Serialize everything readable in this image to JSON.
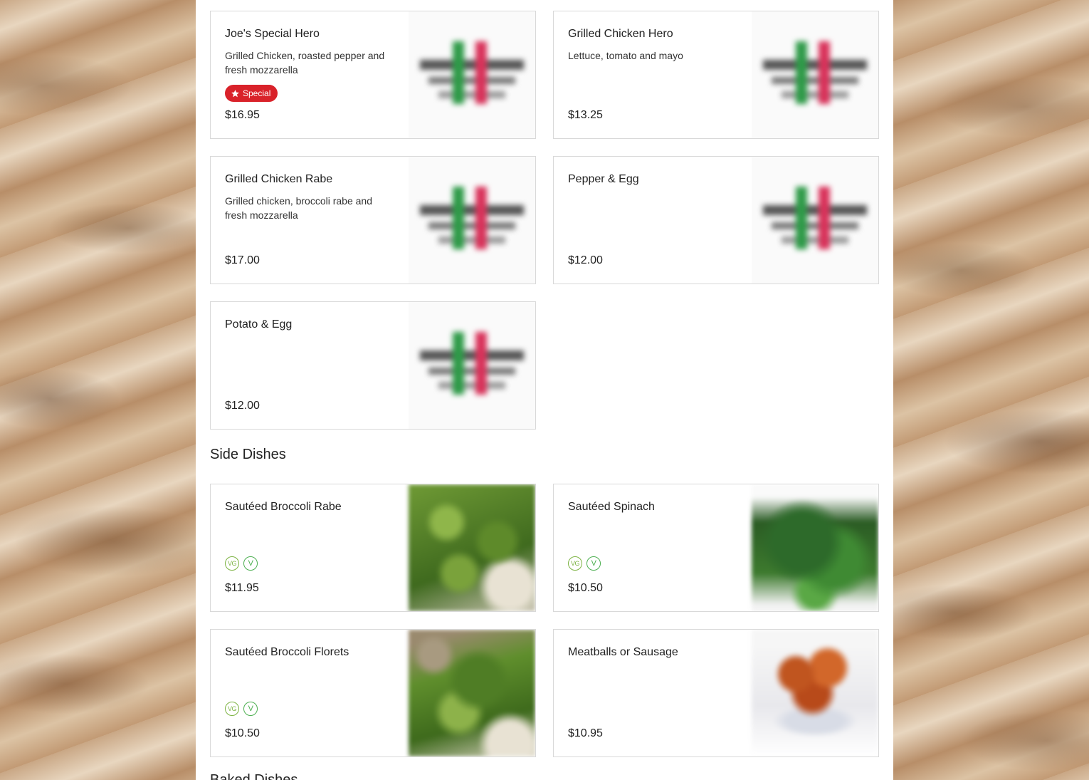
{
  "colors": {
    "special_badge": "#d9222a",
    "vegan_icon": "#7cb342",
    "vegetarian_icon": "#4caf50"
  },
  "hero_items": [
    {
      "name": "Joe's Special Hero",
      "description": "Grilled Chicken, roasted pepper and fresh mozzarella",
      "badge": "Special",
      "badge_icon": "star-icon",
      "price": "$16.95",
      "image": "restaurant-logo"
    },
    {
      "name": "Grilled Chicken Hero",
      "description": "Lettuce, tomato and mayo",
      "price": "$13.25",
      "image": "restaurant-logo"
    },
    {
      "name": "Grilled Chicken Rabe",
      "description": "Grilled chicken, broccoli rabe and fresh mozzarella",
      "price": "$17.00",
      "image": "restaurant-logo"
    },
    {
      "name": "Pepper & Egg",
      "description": "",
      "price": "$12.00",
      "image": "restaurant-logo"
    },
    {
      "name": "Potato & Egg",
      "description": "",
      "price": "$12.00",
      "image": "restaurant-logo"
    }
  ],
  "side_dishes": {
    "title": "Side Dishes",
    "items": [
      {
        "name": "Sautéed Broccoli Rabe",
        "diet_tags": [
          "VG",
          "V"
        ],
        "price": "$11.95",
        "image": "broccoli-rabe-photo"
      },
      {
        "name": "Sautéed Spinach",
        "diet_tags": [
          "VG",
          "V"
        ],
        "price": "$10.50",
        "image": "spinach-photo"
      },
      {
        "name": "Sautéed Broccoli Florets",
        "diet_tags": [
          "VG",
          "V"
        ],
        "price": "$10.50",
        "image": "broccoli-florets-photo"
      },
      {
        "name": "Meatballs or Sausage",
        "diet_tags": [],
        "price": "$10.95",
        "image": "meatballs-photo"
      }
    ]
  },
  "next_section": {
    "title": "Baked Dishes"
  }
}
